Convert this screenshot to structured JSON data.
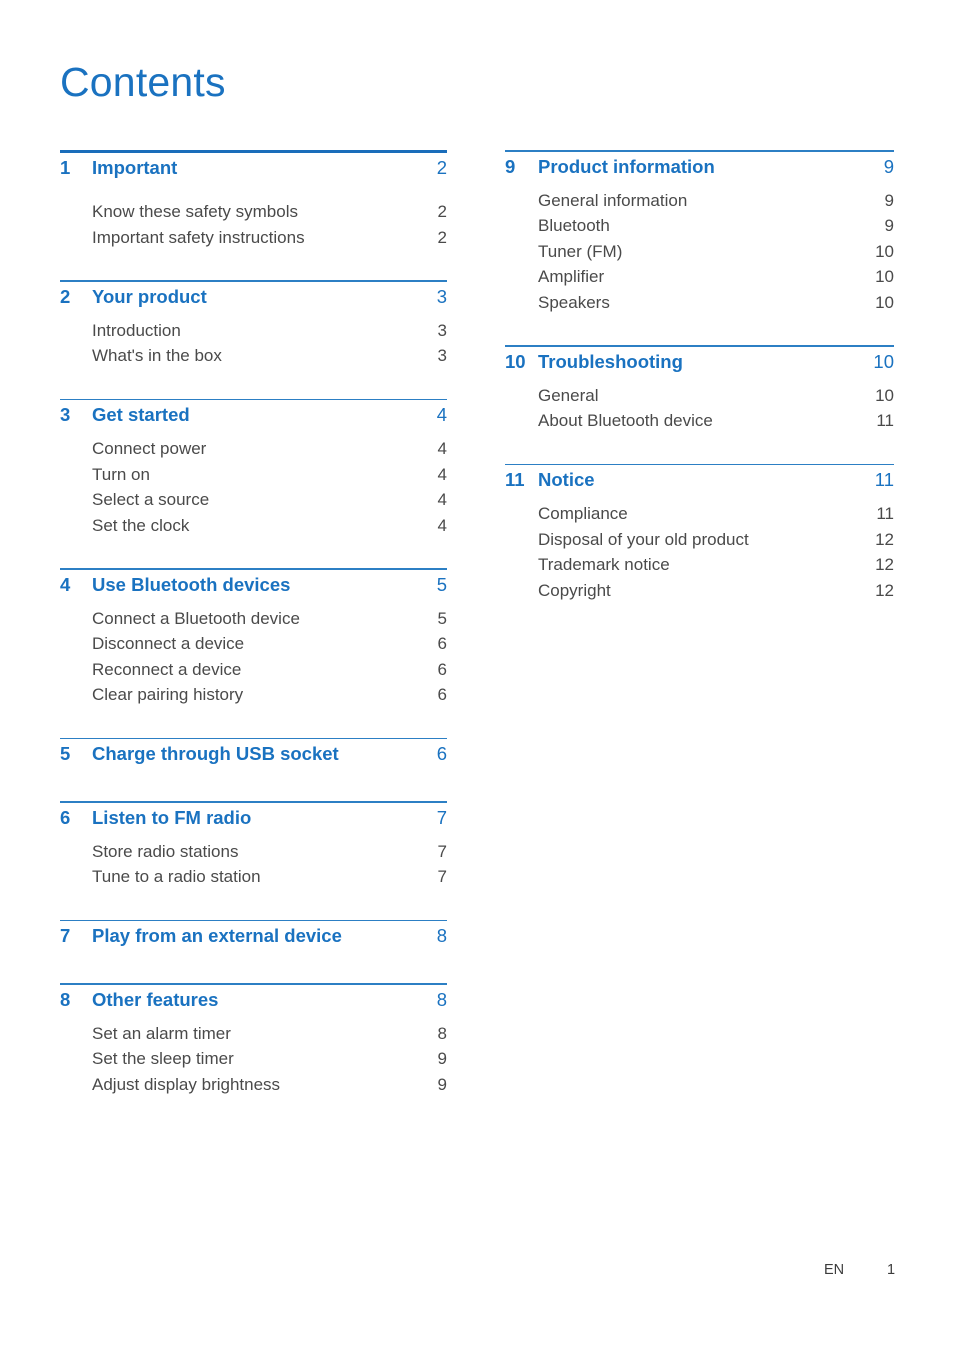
{
  "document": {
    "title": "Contents",
    "accent_color": "#1a72c0",
    "rule_color": "#2c7fc4",
    "text_color": "#4a4a4a"
  },
  "footer": {
    "language": "EN",
    "page_number": "1"
  },
  "columns": {
    "left": [
      {
        "number": "1",
        "title": "Important",
        "page": "2",
        "extra_gap": true,
        "items": [
          {
            "label": "Know these safety symbols",
            "page": "2"
          },
          {
            "label": "Important safety instructions",
            "page": "2"
          }
        ]
      },
      {
        "number": "2",
        "title": "Your product",
        "page": "3",
        "extra_gap": false,
        "items": [
          {
            "label": "Introduction",
            "page": "3"
          },
          {
            "label": "What's in the box",
            "page": "3"
          }
        ]
      },
      {
        "number": "3",
        "title": "Get started",
        "page": "4",
        "extra_gap": false,
        "items": [
          {
            "label": "Connect power",
            "page": "4"
          },
          {
            "label": "Turn on",
            "page": "4"
          },
          {
            "label": "Select a source",
            "page": "4"
          },
          {
            "label": "Set the clock",
            "page": "4"
          }
        ]
      },
      {
        "number": "4",
        "title": "Use Bluetooth devices",
        "page": "5",
        "extra_gap": false,
        "items": [
          {
            "label": "Connect a Bluetooth device",
            "page": "5"
          },
          {
            "label": "Disconnect a device",
            "page": "6"
          },
          {
            "label": "Reconnect a device",
            "page": "6"
          },
          {
            "label": "Clear pairing history",
            "page": "6"
          }
        ]
      },
      {
        "number": "5",
        "title": "Charge through USB socket",
        "page": "6",
        "extra_gap": false,
        "items": []
      },
      {
        "number": "6",
        "title": "Listen to FM radio",
        "page": "7",
        "extra_gap": false,
        "items": [
          {
            "label": "Store radio stations",
            "page": "7"
          },
          {
            "label": "Tune to a radio station",
            "page": "7"
          }
        ]
      },
      {
        "number": "7",
        "title": "Play from an external device",
        "page": "8",
        "extra_gap": false,
        "items": []
      },
      {
        "number": "8",
        "title": "Other features",
        "page": "8",
        "extra_gap": false,
        "items": [
          {
            "label": "Set an alarm timer",
            "page": "8"
          },
          {
            "label": "Set the sleep timer",
            "page": "9"
          },
          {
            "label": "Adjust display brightness",
            "page": "9"
          }
        ]
      }
    ],
    "right": [
      {
        "number": "9",
        "title": "Product information",
        "page": "9",
        "extra_gap": false,
        "items": [
          {
            "label": "General information",
            "page": "9"
          },
          {
            "label": "Bluetooth",
            "page": "9"
          },
          {
            "label": "Tuner (FM)",
            "page": "10"
          },
          {
            "label": "Amplifier",
            "page": "10"
          },
          {
            "label": "Speakers",
            "page": "10"
          }
        ]
      },
      {
        "number": "10",
        "title": "Troubleshooting",
        "page": "10",
        "extra_gap": false,
        "items": [
          {
            "label": "General",
            "page": "10"
          },
          {
            "label": "About Bluetooth device",
            "page": "11"
          }
        ]
      },
      {
        "number": "11",
        "title": "Notice",
        "page": "11",
        "extra_gap": false,
        "items": [
          {
            "label": "Compliance",
            "page": "11"
          },
          {
            "label": "Disposal of your old product",
            "page": "12"
          },
          {
            "label": "Trademark notice",
            "page": "12"
          },
          {
            "label": "Copyright",
            "page": "12"
          }
        ]
      }
    ]
  }
}
